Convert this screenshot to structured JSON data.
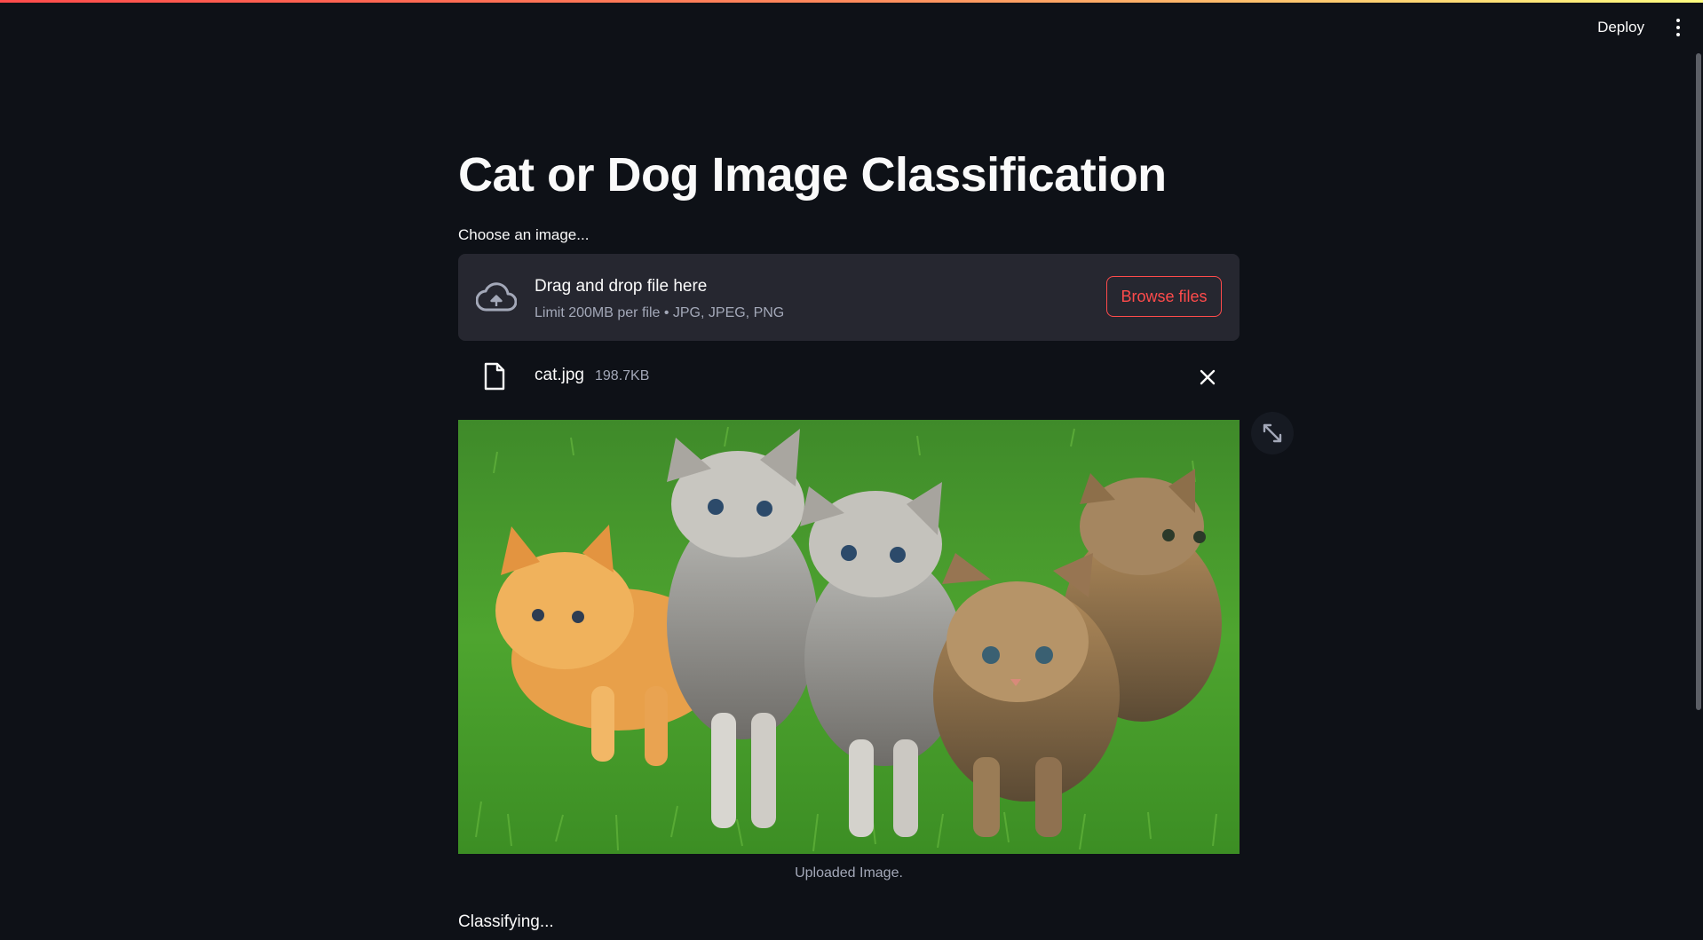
{
  "header": {
    "deploy_label": "Deploy"
  },
  "main": {
    "title": "Cat or Dog Image Classification",
    "uploader": {
      "label": "Choose an image...",
      "dropzone_title": "Drag and drop file here",
      "limit_text": "Limit 200MB per file • JPG, JPEG, PNG",
      "browse_label": "Browse files"
    },
    "uploaded_file": {
      "name": "cat.jpg",
      "size": "198.7KB"
    },
    "image_caption": "Uploaded Image.",
    "status_text": "Classifying..."
  },
  "colors": {
    "background": "#0e1117",
    "dropzone": "#262730",
    "accent": "#ff4b4b",
    "muted_text": "#a3a8b8"
  },
  "icons": {
    "upload": "cloud-upload-icon",
    "file": "file-icon",
    "remove": "close-icon",
    "fullscreen": "expand-icon",
    "menu": "vertical-dots-icon"
  }
}
